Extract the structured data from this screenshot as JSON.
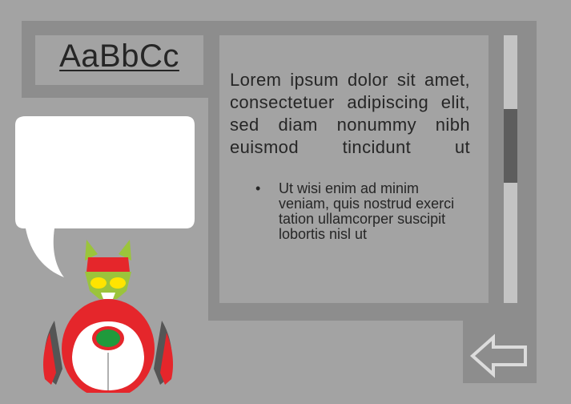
{
  "title": "AaBbCc",
  "content": {
    "paragraph": "Lorem ipsum dolor sit amet, consectetuer adipiscing elit, sed diam nonummy nibh euismod tincidunt ut",
    "bullets": [
      {
        "marker": "•",
        "text": "Ut wisi enim ad minim veniam, quis nostrud exerci tation ullamcorper suscipit lobortis nisl ut"
      }
    ]
  },
  "scrollbar": {
    "thumb_start_fraction": 0.28,
    "thumb_size_fraction": 0.27
  },
  "icons": {
    "back_button": "arrow-left-icon",
    "character": "robot-mascot"
  },
  "colors": {
    "background": "#a3a3a3",
    "frame": "#8d8d8d",
    "scroll_track": "#c4c4c4",
    "scroll_thumb": "#5d5d5d",
    "robot_red": "#e5262b",
    "robot_green": "#9bc43b",
    "robot_gem": "#1f9a3c"
  }
}
